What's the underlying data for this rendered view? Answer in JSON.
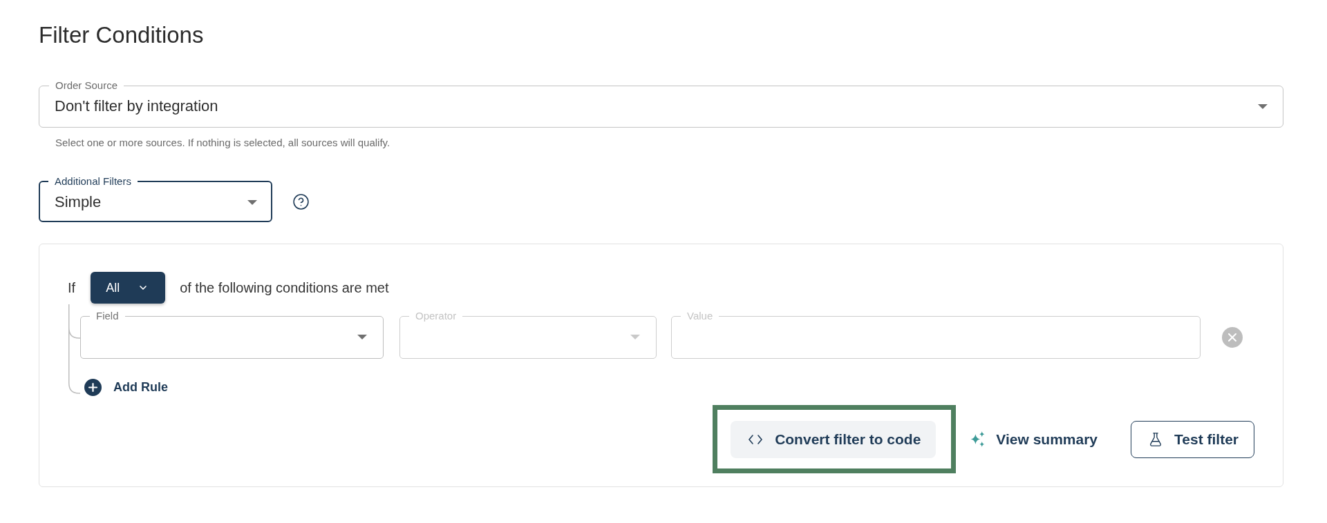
{
  "title": "Filter Conditions",
  "order_source": {
    "label": "Order Source",
    "value": "Don't filter by integration",
    "focused": false,
    "helper": "Select one or more sources. If nothing is selected, all sources will qualify."
  },
  "additional_filters": {
    "label": "Additional Filters",
    "value": "Simple",
    "focused": true
  },
  "conditions": {
    "prefix": "If",
    "match": "All",
    "suffix": "of the following conditions are met",
    "rules": [
      {
        "fields": [
          {
            "kind": "select",
            "label": "Field",
            "disabled": false
          },
          {
            "kind": "select",
            "label": "Operator",
            "disabled": true
          },
          {
            "kind": "text",
            "label": "Value",
            "disabled": true
          }
        ]
      }
    ],
    "add_rule": "Add Rule"
  },
  "actions": [
    {
      "kind": "code",
      "label": "Convert filter to code",
      "highlighted": true
    },
    {
      "kind": "summary",
      "label": "View summary",
      "highlighted": false
    },
    {
      "kind": "test",
      "label": "Test filter",
      "highlighted": false
    }
  ]
}
